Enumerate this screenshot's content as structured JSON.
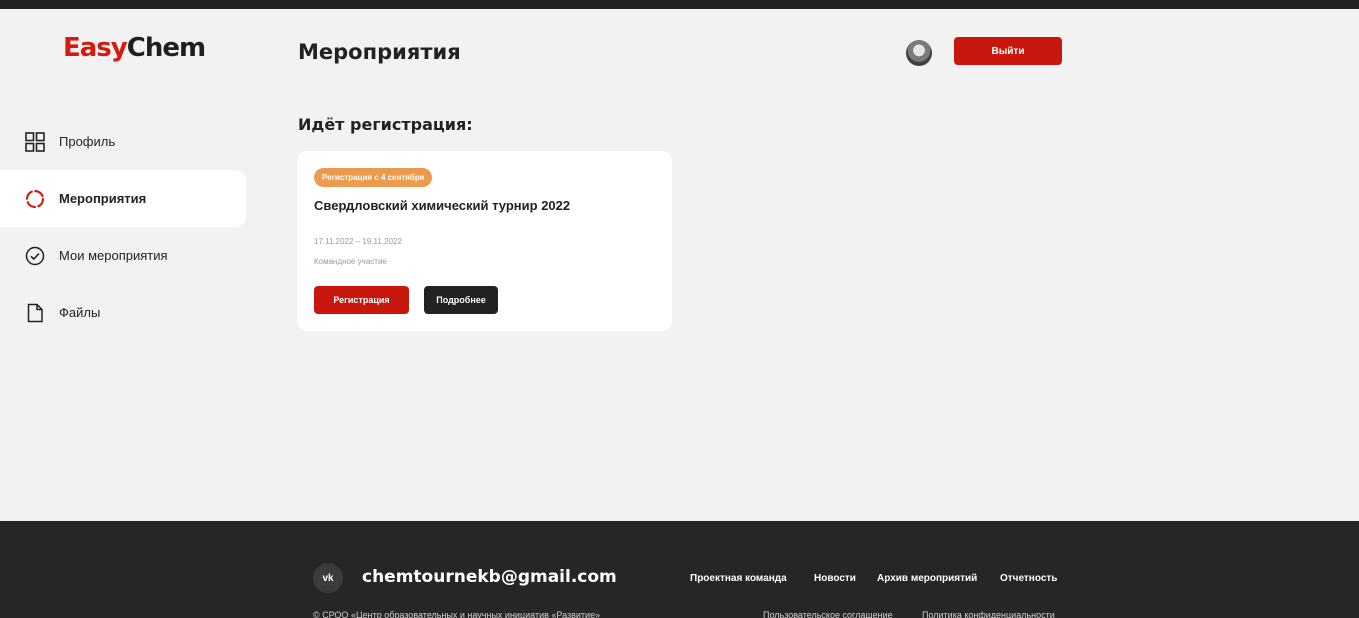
{
  "brand": {
    "part1": "Easy",
    "part2": "Chem"
  },
  "header": {
    "title": "Мероприятия",
    "logout_label": "Выйти"
  },
  "sidebar": {
    "items": [
      {
        "label": "Профиль",
        "icon": "grid-icon",
        "active": false
      },
      {
        "label": "Мероприятия",
        "icon": "spinner-icon",
        "active": true
      },
      {
        "label": "Мои мероприятия",
        "icon": "check-circle-icon",
        "active": false
      },
      {
        "label": "Файлы",
        "icon": "file-icon",
        "active": false
      }
    ]
  },
  "main": {
    "section_title": "Идёт регистрация:",
    "event": {
      "badge": "Регистрация с 4 сентября",
      "title": "Свердловский химический турнир 2022",
      "dates": "17.11.2022 – 19.11.2022",
      "participation": "Командное участие",
      "register_label": "Регистрация",
      "details_label": "Подробнее"
    }
  },
  "footer": {
    "vk_label": "vk",
    "email": "chemtournekb@gmail.com",
    "links": [
      "Проектная команда",
      "Новости",
      "Архив мероприятий",
      "Отчетность"
    ],
    "copyright": "© СРОО «Центр образовательных и научных инициатив «Развитие»",
    "legal_links": [
      "Пользовательское соглашение",
      "Политика конфиденциальности"
    ]
  },
  "colors": {
    "accent": "#c8180e",
    "badge": "#ec9a4e",
    "footer_bg": "#262626",
    "page_bg": "#f2f2f2"
  }
}
